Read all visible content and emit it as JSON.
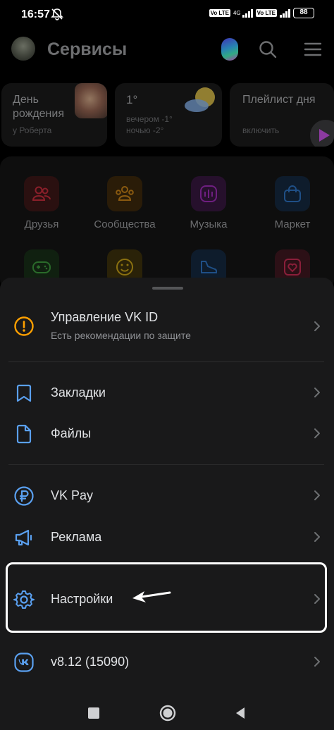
{
  "status_bar": {
    "time": "16:57",
    "volte_1": "Vo LTE",
    "net_type": "4G",
    "volte_2": "Vo LTE",
    "battery": "88"
  },
  "header": {
    "title": "Сервисы",
    "icons": [
      "avatar",
      "marusia-icon",
      "search-icon",
      "menu-icon"
    ]
  },
  "widgets": [
    {
      "title": "День рождения",
      "subtitle": "у Роберта"
    },
    {
      "title": "1°",
      "line1": "вечером -1°",
      "line2": "ночью -2°"
    },
    {
      "title": "Плейлист дня",
      "subtitle": "включить"
    }
  ],
  "services": [
    {
      "label": "Друзья",
      "icon": "users-icon",
      "color": "#ff3347"
    },
    {
      "label": "Сообщества",
      "icon": "community-icon",
      "color": "#ffa000"
    },
    {
      "label": "Музыка",
      "icon": "music-icon",
      "color": "#c63de6"
    },
    {
      "label": "Маркет",
      "icon": "bag-icon",
      "color": "#2d81e0"
    },
    {
      "label": "",
      "icon": "gamepad-icon",
      "color": "#4bb34b"
    },
    {
      "label": "",
      "icon": "smile-icon",
      "color": "#ffc107"
    },
    {
      "label": "",
      "icon": "sneaker-icon",
      "color": "#2d81e0"
    },
    {
      "label": "",
      "icon": "heart-card-icon",
      "color": "#e64646"
    }
  ],
  "sheet": {
    "vkid": {
      "label": "Управление VK ID",
      "subtitle": "Есть рекомендации по защите",
      "icon": "warning-circle-icon",
      "color": "#ffa000"
    },
    "items": [
      {
        "label": "Закладки",
        "icon": "bookmark-icon"
      },
      {
        "label": "Файлы",
        "icon": "file-icon"
      },
      {
        "label": "VK Pay",
        "icon": "vkpay-icon"
      },
      {
        "label": "Реклама",
        "icon": "megaphone-icon"
      },
      {
        "label": "Настройки",
        "icon": "gear-icon"
      },
      {
        "label": "v8.12 (15090)",
        "icon": "vk-logo-icon"
      }
    ],
    "accent": "#5aa0f0"
  },
  "navbar": [
    "recents-button",
    "home-button",
    "back-button"
  ]
}
